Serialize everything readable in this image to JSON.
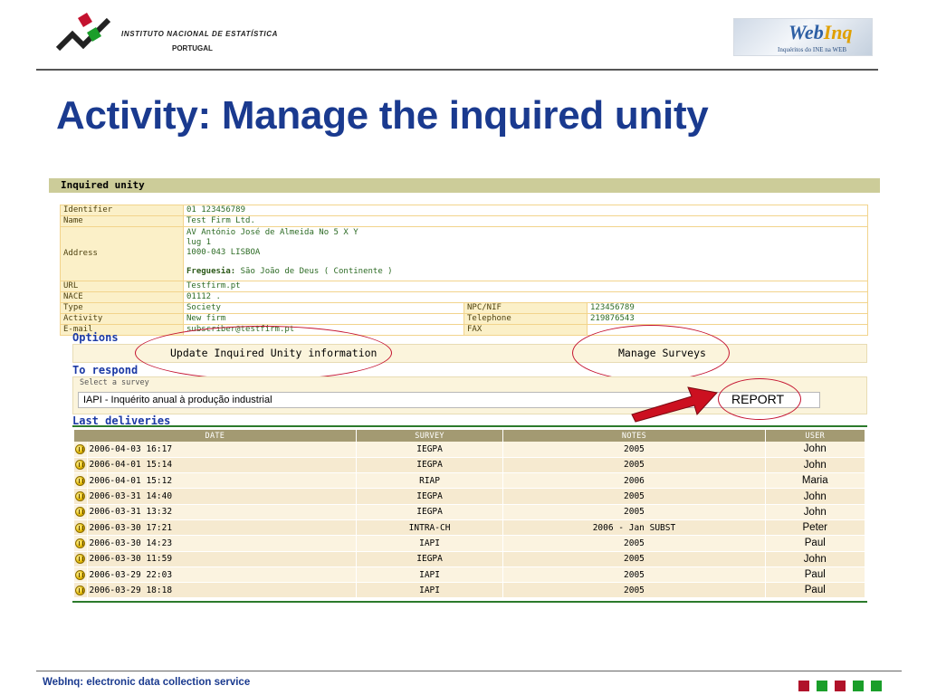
{
  "header": {
    "org_line1": "INSTITUTO  NACIONAL  DE  ESTATÍSTICA",
    "org_line2": "PORTUGAL",
    "brand_web": "Web",
    "brand_inq": "Inq",
    "brand_tagline": "Inquéritos do INE na WEB"
  },
  "title": "Activity: Manage the inquired unity",
  "panel_title": "Inquired unity",
  "unit": {
    "identifier_label": "Identifier",
    "identifier": "01 123456789",
    "name_label": "Name",
    "name": "Test Firm Ltd.",
    "address_label": "Address",
    "address_line1": "AV António José de Almeida No 5 X Y",
    "address_line2": "lug 1",
    "address_line3": "1000-043 LISBOA",
    "freguesia_label": "Freguesia:",
    "freguesia": "São João de Deus ( Continente )",
    "url_label": "URL",
    "url": "Testfirm.pt",
    "nace_label": "NACE",
    "nace": "01112 .",
    "type_label": "Type",
    "type": "Society",
    "npc_label": "NPC/NIF",
    "npc": "123456789",
    "activity_label": "Activity",
    "activity": "New firm",
    "telephone_label": "Telephone",
    "telephone": "219876543",
    "email_label": "E-mail",
    "email": "subscriber@testfirm.pt",
    "fax_label": "FAX",
    "fax": ""
  },
  "options": {
    "heading": "Options",
    "update": "Update Inquired Unity information",
    "manage": "Manage Surveys"
  },
  "respond": {
    "heading": "To respond",
    "hint": "Select a survey",
    "selected_survey": "IAPI - Inquérito anual à produção industrial",
    "report": "REPORT"
  },
  "deliveries": {
    "heading": "Last deliveries",
    "columns": [
      "DATE",
      "SURVEY",
      "NOTES",
      "USER"
    ],
    "rows": [
      {
        "date": "2006-04-03 16:17",
        "survey": "IEGPA",
        "notes": "2005",
        "user": "John"
      },
      {
        "date": "2006-04-01 15:14",
        "survey": "IEGPA",
        "notes": "2005",
        "user": "John"
      },
      {
        "date": "2006-04-01 15:12",
        "survey": "RIAP",
        "notes": "2006",
        "user": "Maria"
      },
      {
        "date": "2006-03-31 14:40",
        "survey": "IEGPA",
        "notes": "2005",
        "user": "John"
      },
      {
        "date": "2006-03-31 13:32",
        "survey": "IEGPA",
        "notes": "2005",
        "user": "John"
      },
      {
        "date": "2006-03-30 17:21",
        "survey": "INTRA-CH",
        "notes": "2006 - Jan SUBST",
        "user": "Peter"
      },
      {
        "date": "2006-03-30 14:23",
        "survey": "IAPI",
        "notes": "2005",
        "user": "Paul"
      },
      {
        "date": "2006-03-30 11:59",
        "survey": "IEGPA",
        "notes": "2005",
        "user": "John"
      },
      {
        "date": "2006-03-29 22:03",
        "survey": "IAPI",
        "notes": "2005",
        "user": "Paul"
      },
      {
        "date": "2006-03-29 18:18",
        "survey": "IAPI",
        "notes": "2005",
        "user": "Paul"
      }
    ]
  },
  "footer": {
    "text": "WebInq: electronic data collection service",
    "colors": [
      "#b0122a",
      "#1a9e2a",
      "#b0122a",
      "#1a9e2a",
      "#1a9e2a"
    ]
  },
  "colors": {
    "title": "#1a3a8f",
    "highlight": "#c4122f",
    "panel_bar": "#cccc99",
    "table_header": "#a39a72"
  }
}
